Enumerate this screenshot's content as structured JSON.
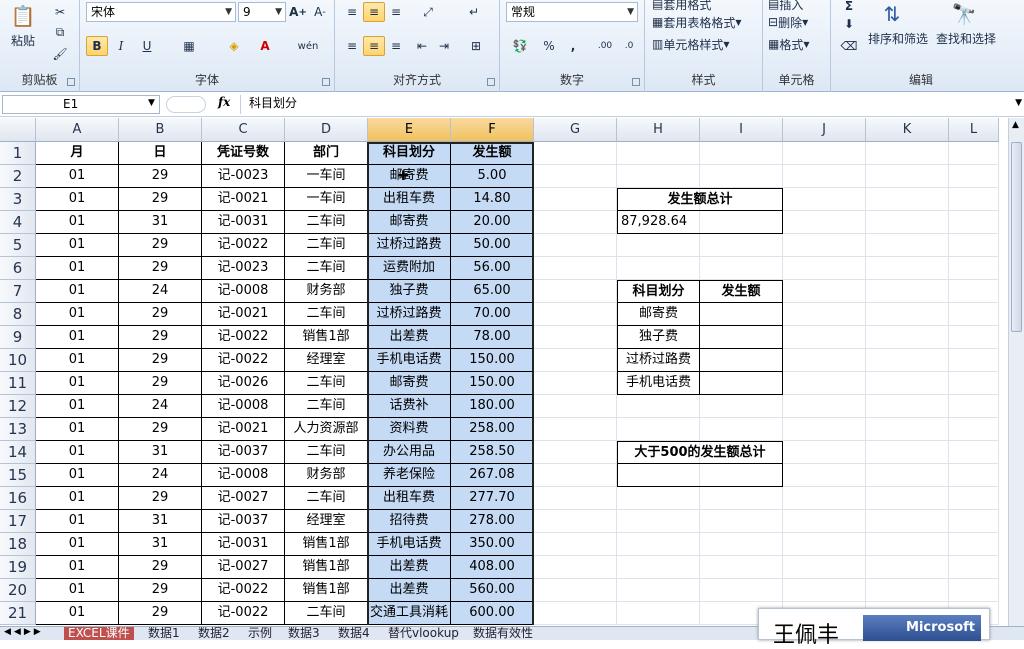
{
  "ribbon": {
    "clipboard": {
      "paste": "粘贴",
      "label": "剪贴板"
    },
    "font": {
      "name": "宋体",
      "size": "9",
      "label": "字体",
      "bold": "B",
      "italic": "I",
      "underline": "U"
    },
    "align": {
      "label": "对齐方式"
    },
    "number": {
      "format": "常规",
      "label": "数字",
      "percent": "%",
      "comma": ","
    },
    "styles": {
      "cond": "套用格式",
      "table": "套用表格格式",
      "cell": "单元格样式",
      "label": "样式"
    },
    "cells": {
      "insert": "插入",
      "delete": "删除",
      "format": "格式",
      "label": "单元格"
    },
    "edit": {
      "sort": "排序和筛选",
      "find": "查找和选择",
      "label": "编辑"
    }
  },
  "formula_bar": {
    "name_box": "E1",
    "fx": "fx",
    "content": "科目划分"
  },
  "columns": [
    "A",
    "B",
    "C",
    "D",
    "E",
    "F",
    "G",
    "H",
    "I",
    "J",
    "K",
    "L"
  ],
  "headers": [
    "月",
    "日",
    "凭证号数",
    "部门",
    "科目划分",
    "发生额"
  ],
  "rows": [
    [
      "01",
      "29",
      "记-0023",
      "一车间",
      "邮寄费",
      "5.00"
    ],
    [
      "01",
      "29",
      "记-0021",
      "一车间",
      "出租车费",
      "14.80"
    ],
    [
      "01",
      "31",
      "记-0031",
      "二车间",
      "邮寄费",
      "20.00"
    ],
    [
      "01",
      "29",
      "记-0022",
      "二车间",
      "过桥过路费",
      "50.00"
    ],
    [
      "01",
      "29",
      "记-0023",
      "二车间",
      "运费附加",
      "56.00"
    ],
    [
      "01",
      "24",
      "记-0008",
      "财务部",
      "独子费",
      "65.00"
    ],
    [
      "01",
      "29",
      "记-0021",
      "二车间",
      "过桥过路费",
      "70.00"
    ],
    [
      "01",
      "29",
      "记-0022",
      "销售1部",
      "出差费",
      "78.00"
    ],
    [
      "01",
      "29",
      "记-0022",
      "经理室",
      "手机电话费",
      "150.00"
    ],
    [
      "01",
      "29",
      "记-0026",
      "二车间",
      "邮寄费",
      "150.00"
    ],
    [
      "01",
      "24",
      "记-0008",
      "二车间",
      "话费补",
      "180.00"
    ],
    [
      "01",
      "29",
      "记-0021",
      "人力资源部",
      "资料费",
      "258.00"
    ],
    [
      "01",
      "31",
      "记-0037",
      "二车间",
      "办公用品",
      "258.50"
    ],
    [
      "01",
      "24",
      "记-0008",
      "财务部",
      "养老保险",
      "267.08"
    ],
    [
      "01",
      "29",
      "记-0027",
      "二车间",
      "出租车费",
      "277.70"
    ],
    [
      "01",
      "31",
      "记-0037",
      "经理室",
      "招待费",
      "278.00"
    ],
    [
      "01",
      "31",
      "记-0031",
      "销售1部",
      "手机电话费",
      "350.00"
    ],
    [
      "01",
      "29",
      "记-0027",
      "销售1部",
      "出差费",
      "408.00"
    ],
    [
      "01",
      "29",
      "记-0022",
      "销售1部",
      "出差费",
      "560.00"
    ],
    [
      "01",
      "29",
      "记-0022",
      "二车间",
      "交通工具消耗",
      "600.00"
    ]
  ],
  "side": {
    "total_title": "发生额总计",
    "total_value": "87,928.64",
    "sub_headers": [
      "科目划分",
      "发生额"
    ],
    "sub_items": [
      "邮寄费",
      "独子费",
      "过桥过路费",
      "手机电话费"
    ],
    "gt500_title": "大于500的发生额总计"
  },
  "sheets": [
    "EXCEL课件",
    "数据1",
    "数据2",
    "示例",
    "数据3",
    "数据4",
    "替代vlookup",
    "数据有效性"
  ],
  "logo": {
    "text": "王佩丰",
    "brand": "Microsoft"
  }
}
